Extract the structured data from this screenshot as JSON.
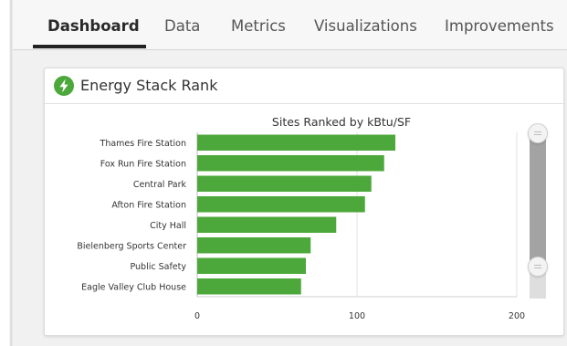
{
  "tabs": [
    {
      "label": "Dashboard",
      "active": true
    },
    {
      "label": "Data",
      "active": false
    },
    {
      "label": "Metrics",
      "active": false
    },
    {
      "label": "Visualizations",
      "active": false
    },
    {
      "label": "Improvements",
      "active": false
    }
  ],
  "card": {
    "title": "Energy Stack Rank",
    "icon": "lightning-bolt-icon",
    "icon_color": "#4ca83a"
  },
  "chart_data": {
    "type": "bar",
    "orientation": "horizontal",
    "title": "Sites Ranked by kBtu/SF",
    "categories": [
      "Thames Fire Station",
      "Fox Run Fire Station",
      "Central Park",
      "Afton Fire Station",
      "City Hall",
      "Bielenberg Sports Center",
      "Public Safety",
      "Eagle Valley Club House"
    ],
    "values": [
      124,
      117,
      109,
      105,
      87,
      71,
      68,
      65
    ],
    "xlim": [
      0,
      200
    ],
    "xticks": [
      "0",
      "100",
      "200"
    ],
    "bar_color": "#4ca83a",
    "grid": true
  },
  "scroller": {
    "range_fraction": [
      0,
      0.8
    ]
  }
}
